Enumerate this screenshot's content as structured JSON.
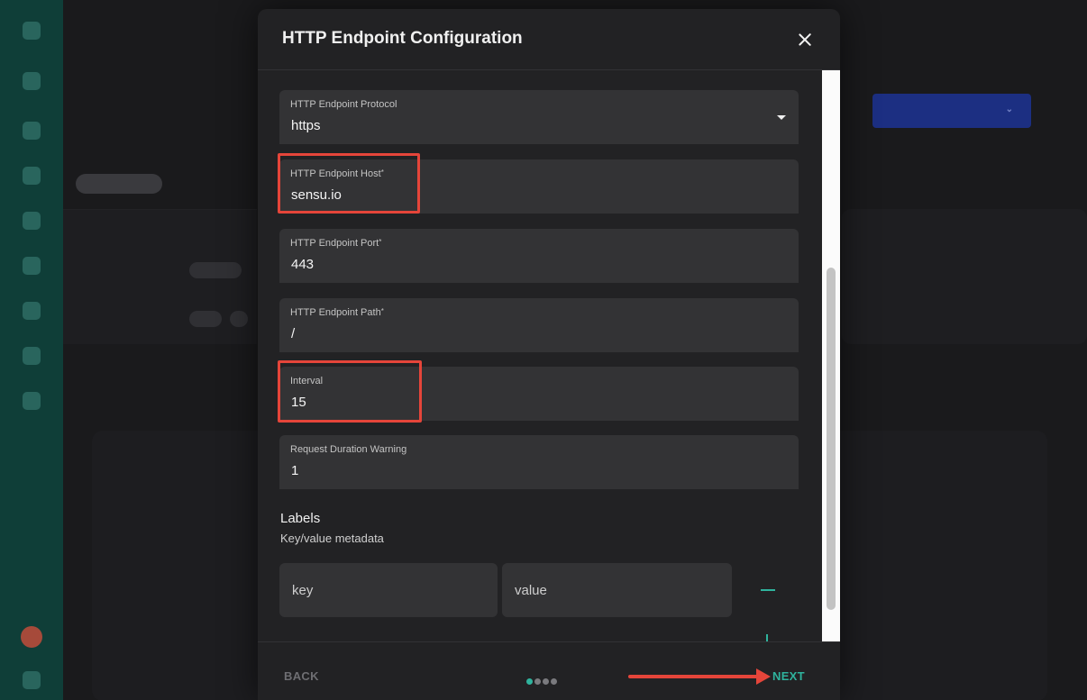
{
  "modal": {
    "title": "HTTP Endpoint Configuration",
    "fields": [
      {
        "label": "HTTP Endpoint Protocol",
        "value": "https",
        "required": false,
        "type": "select"
      },
      {
        "label": "HTTP Endpoint Host",
        "value": "sensu.io",
        "required": true
      },
      {
        "label": "HTTP Endpoint Port",
        "value": "443",
        "required": true
      },
      {
        "label": "HTTP Endpoint Path",
        "value": "/",
        "required": true
      },
      {
        "label": "Interval",
        "value": "15",
        "required": false
      },
      {
        "label": "Request Duration Warning",
        "value": "1",
        "required": false
      }
    ],
    "required_marker": "*",
    "labels": {
      "title": "Labels",
      "subtitle": "Key/value metadata",
      "key_placeholder": "key",
      "value_placeholder": "value"
    },
    "footer": {
      "back_label": "BACK",
      "next_label": "NEXT",
      "steps_total": 4,
      "current_step": 1
    }
  },
  "annotations": {
    "color": "#e5453a",
    "highlighted_fields": [
      "HTTP Endpoint Host",
      "Interval"
    ],
    "arrow_target": "NEXT"
  },
  "colors": {
    "accent": "#2fb39d",
    "modal_bg": "#222224",
    "field_bg": "#333335"
  }
}
